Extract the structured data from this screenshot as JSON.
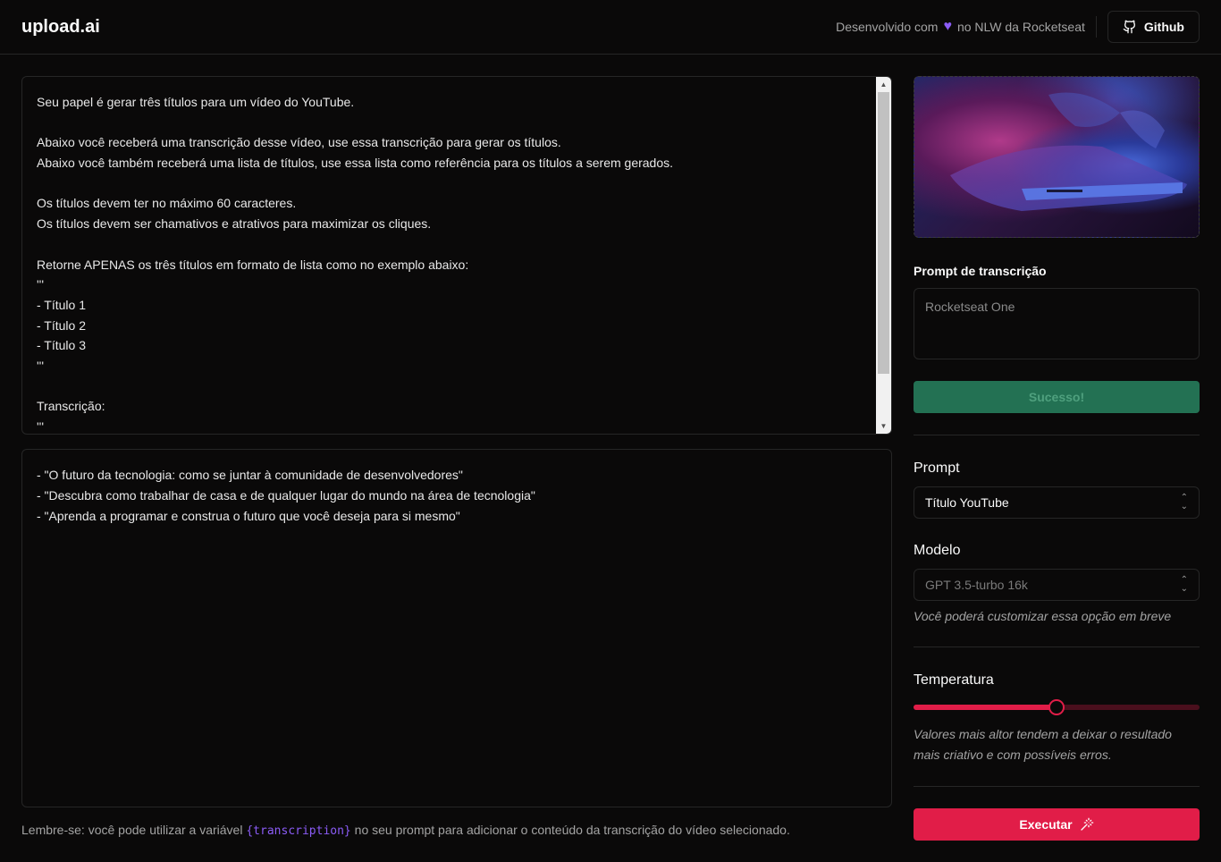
{
  "header": {
    "logo": "upload.ai",
    "dev_prefix": "Desenvolvido com",
    "dev_suffix": "no NLW da Rocketseat",
    "github_label": "Github"
  },
  "prompt_editor": {
    "lines": [
      "Seu papel é gerar três títulos para um vídeo do YouTube.",
      "",
      "Abaixo você receberá uma transcrição desse vídeo, use essa transcrição para gerar os títulos.",
      "Abaixo você também receberá uma lista de títulos, use essa lista como referência para os títulos a serem gerados.",
      "",
      "Os títulos devem ter no máximo 60 caracteres.",
      "Os títulos devem ser chamativos e atrativos para maximizar os cliques.",
      "",
      "Retorne APENAS os três títulos em formato de lista como no exemplo abaixo:",
      "'''",
      "- Título 1",
      "- Título 2",
      "- Título 3",
      "'''",
      "",
      "Transcrição:",
      "'''"
    ]
  },
  "result": {
    "lines": [
      "- \"O futuro da tecnologia: como se juntar à comunidade de desenvolvedores\"",
      "- \"Descubra como trabalhar de casa e de qualquer lugar do mundo na área de tecnologia\"",
      "- \"Aprenda a programar e construa o futuro que você deseja para si mesmo\""
    ]
  },
  "hint": {
    "prefix": "Lembre-se: você pode utilizar a variável",
    "variable": "{transcription}",
    "suffix": "no seu prompt para adicionar o conteúdo da transcrição do vídeo selecionado."
  },
  "sidebar": {
    "transcription_label": "Prompt de transcrição",
    "transcription_placeholder": "Rocketseat One",
    "success_label": "Sucesso!",
    "prompt_label": "Prompt",
    "prompt_value": "Título YouTube",
    "model_label": "Modelo",
    "model_value": "GPT 3.5-turbo 16k",
    "model_note": "Você poderá customizar essa opção em breve",
    "temperature_label": "Temperatura",
    "temperature_value": 0.5,
    "temperature_note": "Valores mais altor tendem a deixar o resultado mais criativo e com possíveis erros.",
    "execute_label": "Executar"
  },
  "colors": {
    "accent": "#e11d48",
    "success": "#237153",
    "highlight": "#8b5cf6"
  }
}
